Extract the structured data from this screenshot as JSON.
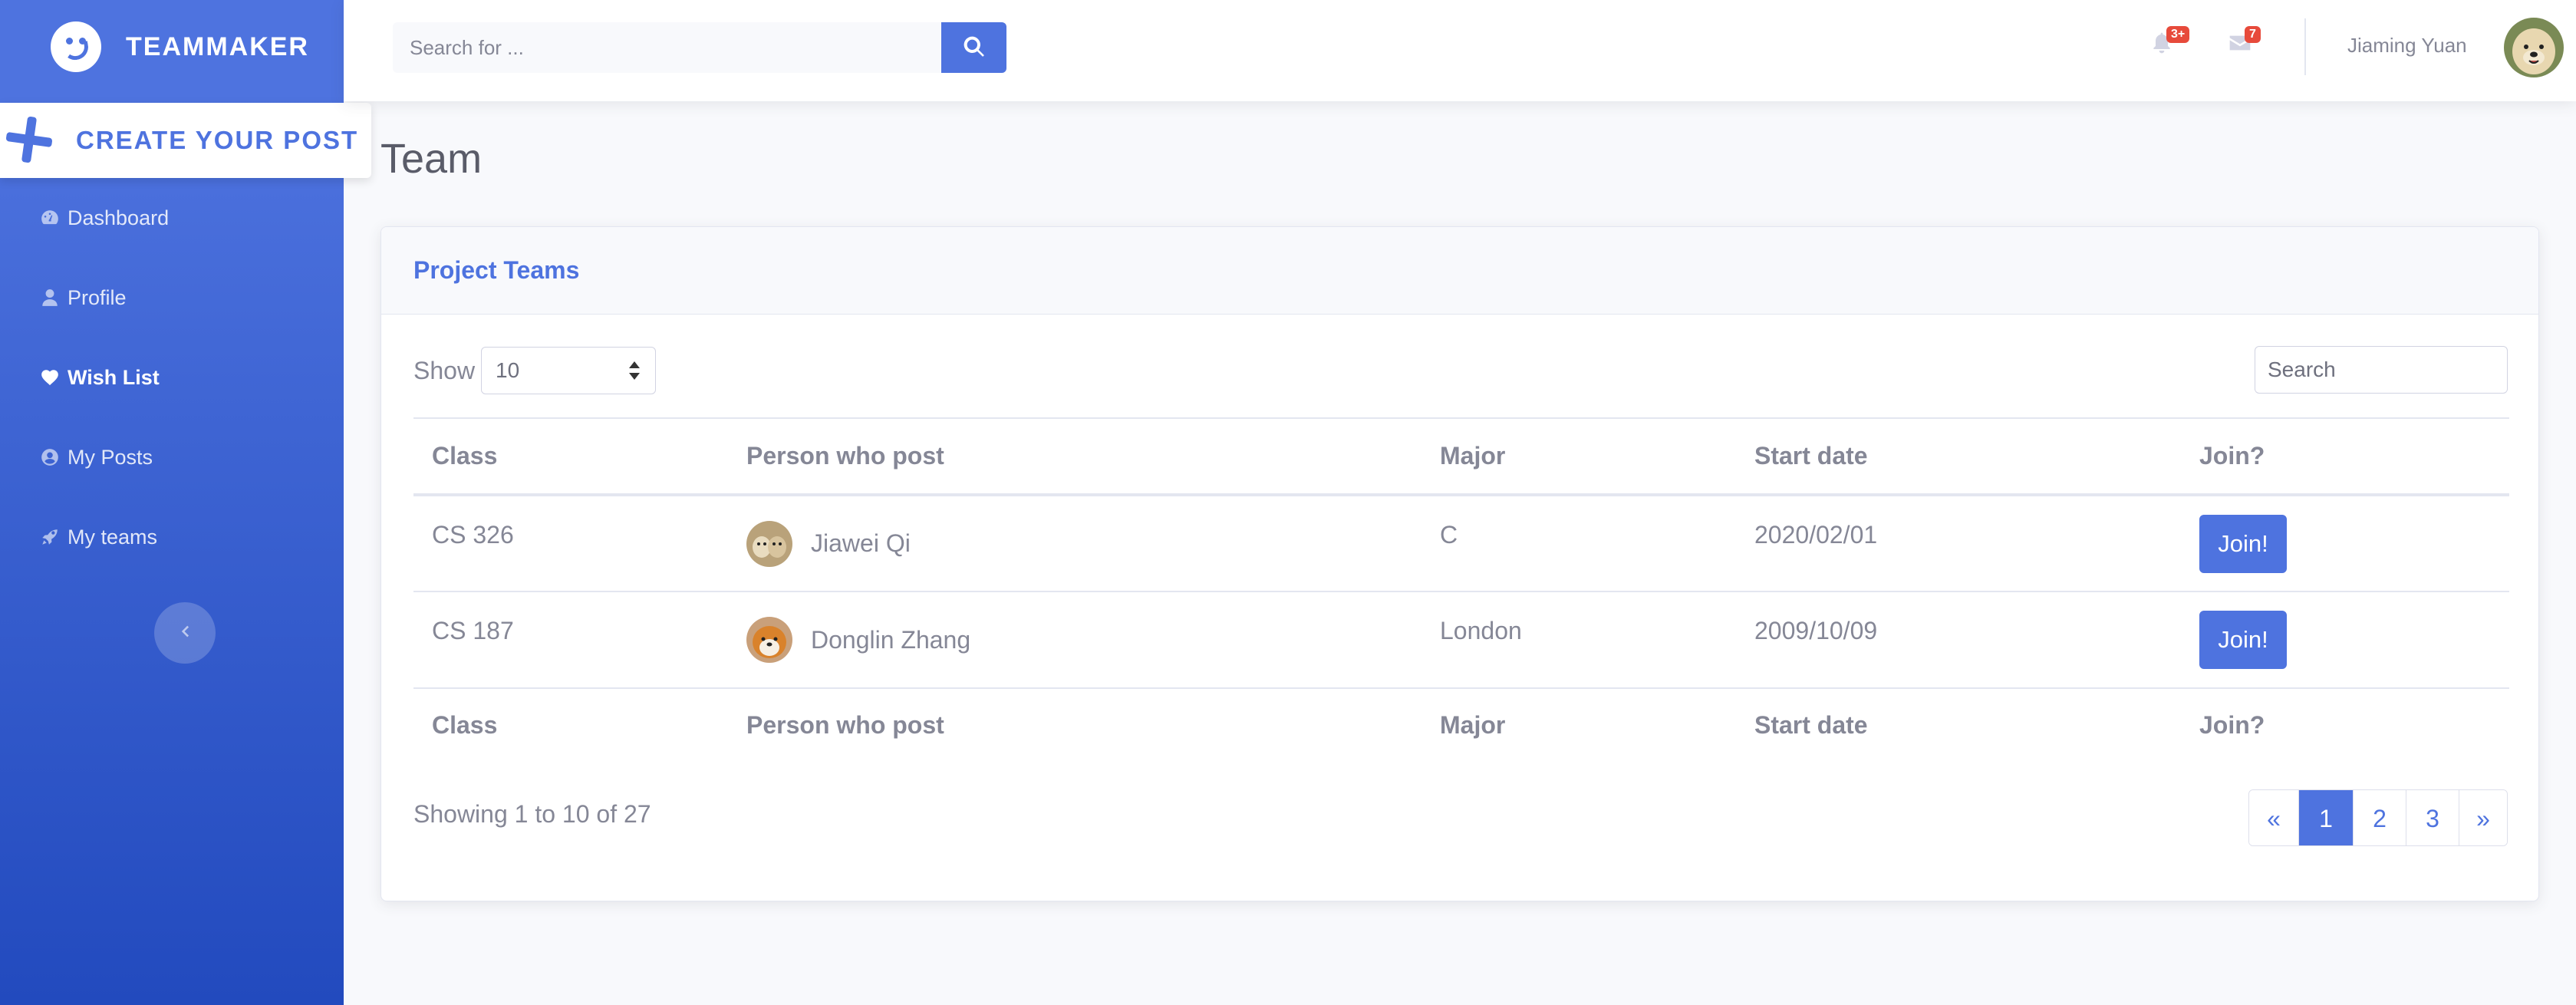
{
  "brand": {
    "name": "TEAMMAKER"
  },
  "sidebar": {
    "create_post": "CREATE YOUR POST",
    "items": [
      {
        "label": "Dashboard",
        "icon": "tachometer-icon"
      },
      {
        "label": "Profile",
        "icon": "user-icon"
      },
      {
        "label": "Wish List",
        "icon": "heart-icon"
      },
      {
        "label": "My Posts",
        "icon": "user-circle-icon"
      },
      {
        "label": "My teams",
        "icon": "rocket-icon"
      }
    ]
  },
  "topbar": {
    "search_placeholder": "Search for ...",
    "alerts_badge": "3+",
    "messages_badge": "7",
    "user_name": "Jiaming Yuan"
  },
  "page": {
    "title": "Team"
  },
  "card": {
    "title": "Project Teams"
  },
  "table_controls": {
    "show_label": "Show",
    "page_size": "10",
    "filter_placeholder": "Search"
  },
  "table": {
    "columns": [
      "Class",
      "Person who post",
      "Major",
      "Start date",
      "Join?"
    ],
    "rows": [
      {
        "class": "CS 326",
        "person": "Jiawei Qi",
        "major": "C",
        "start_date": "2020/02/01",
        "action": "Join!"
      },
      {
        "class": "CS 187",
        "person": "Donglin Zhang",
        "major": "London",
        "start_date": "2009/10/09",
        "action": "Join!"
      }
    ]
  },
  "pagination": {
    "info": "Showing 1 to 10 of 27",
    "prev": "«",
    "pages": [
      "1",
      "2",
      "3"
    ],
    "next": "»"
  },
  "colors": {
    "primary": "#4e73df",
    "badge": "#e74a3b",
    "text": "#858796"
  }
}
